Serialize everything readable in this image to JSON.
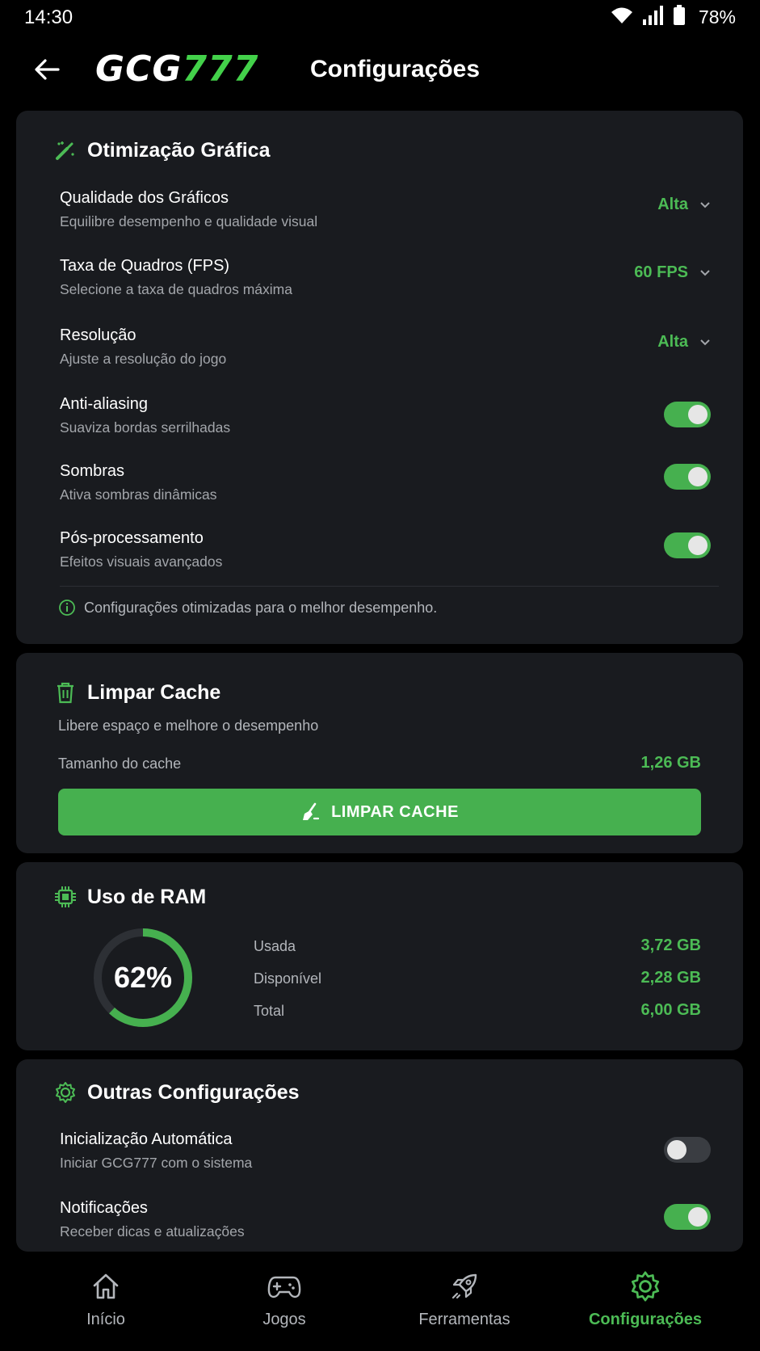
{
  "status_bar": {
    "time": "14:30",
    "battery": "78%"
  },
  "header": {
    "logo_white": "GCG",
    "logo_green": "777",
    "title": "Configurações"
  },
  "graphics": {
    "title": "Otimização Gráfica",
    "rows": [
      {
        "label": "Qualidade dos Gráficos",
        "sub": "Equilibre desempenho e qualidade visual",
        "value": "Alta"
      },
      {
        "label": "Taxa de Quadros (FPS)",
        "sub": "Selecione a taxa de quadros máxima",
        "value": "60 FPS"
      },
      {
        "label": "Resolução",
        "sub": "Ajuste a resolução do jogo",
        "value": "Alta"
      }
    ],
    "toggles": [
      {
        "label": "Anti-aliasing",
        "sub": "Suaviza bordas serrilhadas",
        "on": true
      },
      {
        "label": "Sombras",
        "sub": "Ativa sombras dinâmicas",
        "on": true
      },
      {
        "label": "Pós-processamento",
        "sub": "Efeitos visuais avançados",
        "on": true
      }
    ],
    "info": "Configurações otimizadas para o melhor desempenho."
  },
  "cache": {
    "title": "Limpar Cache",
    "subtitle": "Libere espaço e melhore o desempenho",
    "size_label": "Tamanho do cache",
    "size_value": "1,26 GB",
    "button_label": "LIMPAR CACHE"
  },
  "ram": {
    "title": "Uso de RAM",
    "percent_label": "62%",
    "percent": 62,
    "used_label": "Usada",
    "used_value": "3,72 GB",
    "available_label": "Disponível",
    "available_value": "2,28 GB",
    "total_label": "Total",
    "total_value": "6,00 GB"
  },
  "other": {
    "title": "Outras Configurações",
    "toggles": [
      {
        "label": "Inicialização Automática",
        "sub": "Iniciar GCG777 com o sistema",
        "on": false
      },
      {
        "label": "Notificações",
        "sub": "Receber dicas e atualizações",
        "on": true
      }
    ]
  },
  "nav": {
    "items": [
      {
        "label": "Início",
        "icon": "home-icon"
      },
      {
        "label": "Jogos",
        "icon": "gamepad-icon"
      },
      {
        "label": "Ferramentas",
        "icon": "rocket-icon"
      },
      {
        "label": "Configurações",
        "icon": "gear-icon",
        "active": true
      }
    ]
  },
  "colors": {
    "accent": "#46b04f",
    "accent_text": "#4cbb55",
    "card": "#191b1f",
    "background": "#000000"
  }
}
